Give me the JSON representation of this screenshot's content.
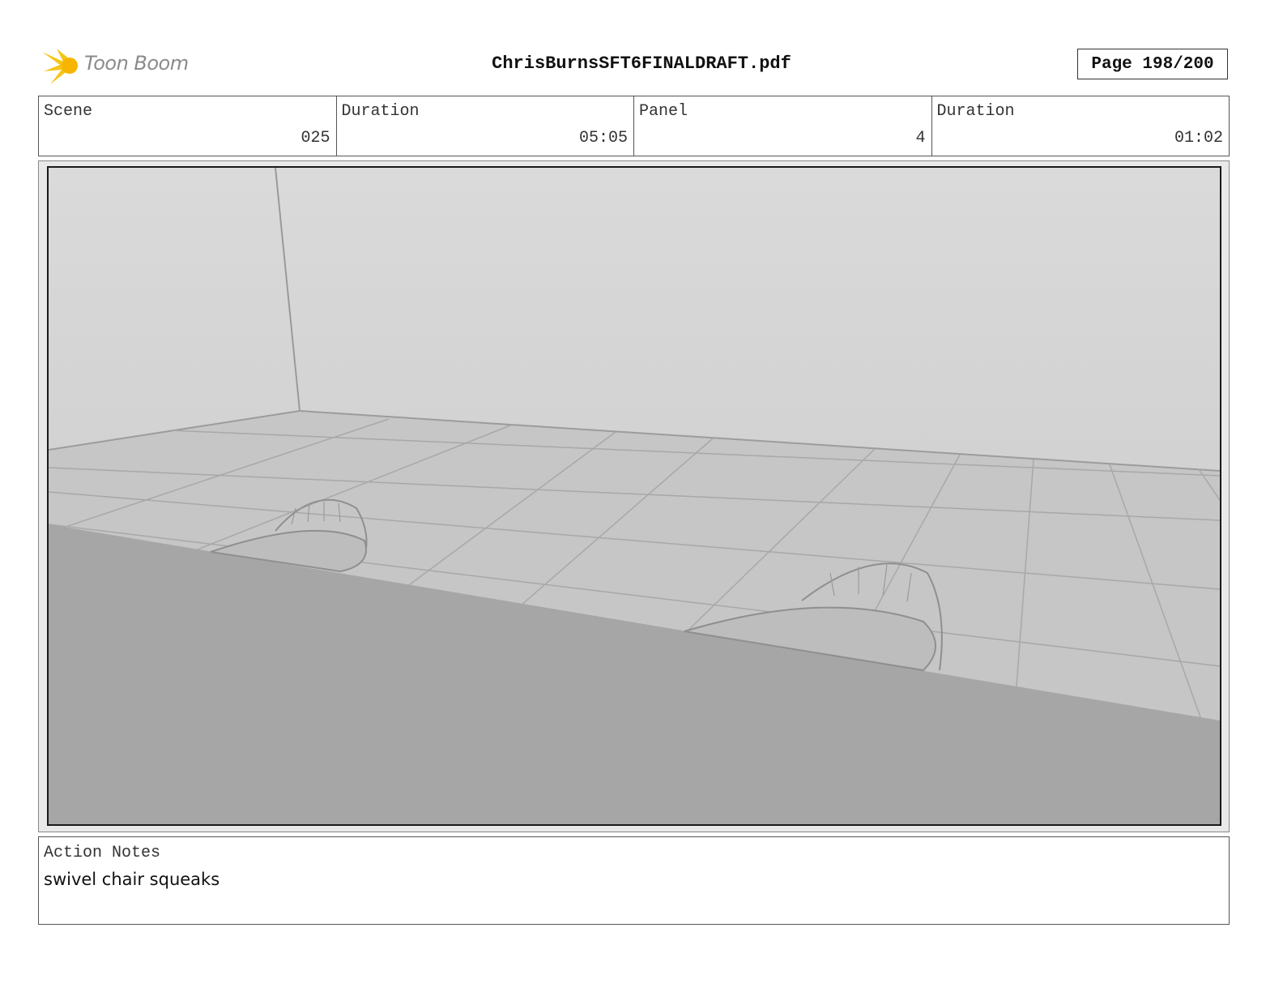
{
  "header": {
    "logo_text": "Toon Boom",
    "file_title": "ChrisBurnsSFT6FINALDRAFT.pdf",
    "page_indicator": "Page 198/200"
  },
  "info": [
    {
      "label": "Scene",
      "value": "025"
    },
    {
      "label": "Duration",
      "value": "05:05"
    },
    {
      "label": "Panel",
      "value": "4"
    },
    {
      "label": "Duration",
      "value": "01:02"
    }
  ],
  "panel": {
    "image_name": "storyboard-panel-sketch"
  },
  "notes": {
    "label": "Action Notes",
    "text": "swivel chair squeaks"
  },
  "colors": {
    "logo_accent": "#f5c518",
    "foreground_desk": "#a6a6a6",
    "wall_top": "#dadada",
    "floor": "#c4c4c4"
  }
}
